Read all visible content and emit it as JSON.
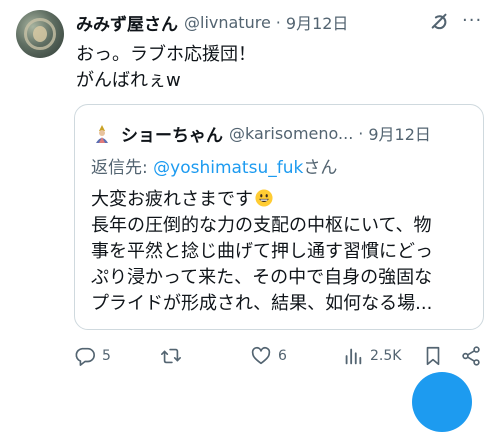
{
  "tweet": {
    "author_name": "みみず屋さん",
    "handle": "@livnature",
    "separator": "·",
    "date": "9月12日",
    "text_line1": "おっ。ラブホ応援団！",
    "text_line2": "がんばれぇw"
  },
  "quote": {
    "author_name": "ショーちゃん",
    "handle": "@karisomeno...",
    "separator": "·",
    "date": "9月12日",
    "replying_label": "返信先: ",
    "replying_mention": "@yoshimatsu_fuk",
    "replying_suffix": "さん",
    "text_line1": "大変お疲れさまです",
    "text_line2": "長年の圧倒的な力の支配の中枢にいて、物",
    "text_line3": "事を平然と捻じ曲げて押し通す習慣にどっ",
    "text_line4": "ぷり浸かって来た、その中で自身の強固な",
    "text_line5": "プライドが形成され、結果、如何なる場..."
  },
  "actions": {
    "replies": "5",
    "retweets": "",
    "likes": "6",
    "views": "2.5K"
  },
  "icons": {
    "grok": "grok-icon",
    "more": "more-icon",
    "reply": "reply-icon",
    "retweet": "retweet-icon",
    "like": "like-icon",
    "views": "views-icon",
    "bookmark": "bookmark-icon",
    "share": "share-icon",
    "emoji": "grinning-face-emoji"
  },
  "colors": {
    "accent": "#1d9bf0",
    "muted": "#536471",
    "text": "#0f1419",
    "border": "#cfd9de"
  }
}
